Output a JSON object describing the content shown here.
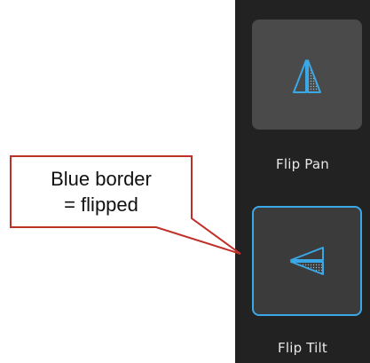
{
  "panel": {
    "buttons": [
      {
        "label": "Flip Pan",
        "icon": "flip-pan-icon",
        "flipped": false
      },
      {
        "label": "Flip Tilt",
        "icon": "flip-tilt-icon",
        "flipped": true
      }
    ],
    "colors": {
      "panel_bg": "#222222",
      "button_bg": "#4a4a4a",
      "flipped_border": "#3aa8e6",
      "icon": "#3aa8e6"
    }
  },
  "callout": {
    "line1": "Blue border",
    "line2": "= flipped",
    "border_color": "#c0302a"
  }
}
